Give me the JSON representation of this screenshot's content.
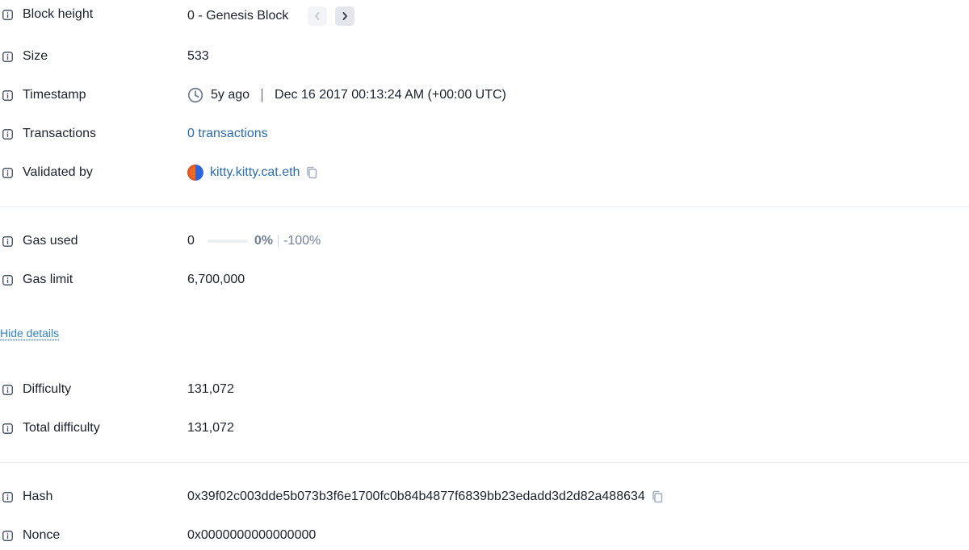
{
  "block_height": {
    "label": "Block height",
    "value": "0 - Genesis Block"
  },
  "size": {
    "label": "Size",
    "value": "533"
  },
  "timestamp": {
    "label": "Timestamp",
    "relative": "5y ago",
    "absolute": "Dec 16 2017 00:13:24 AM (+00:00 UTC)"
  },
  "transactions": {
    "label": "Transactions",
    "value": "0 transactions"
  },
  "validated_by": {
    "label": "Validated by",
    "value": "kitty.kitty.cat.eth"
  },
  "gas_used": {
    "label": "Gas used",
    "value": "0",
    "percent_label": "0%",
    "percent": 0,
    "delta": "-100%"
  },
  "gas_limit": {
    "label": "Gas limit",
    "value": "6,700,000"
  },
  "hide_details": "Hide details",
  "difficulty": {
    "label": "Difficulty",
    "value": "131,072"
  },
  "total_difficulty": {
    "label": "Total difficulty",
    "value": "131,072"
  },
  "hash": {
    "label": "Hash",
    "value": "0x39f02c003dde5b073b3f6e1700fc0b84b4877f6839bb23edadd3d2d82a488634"
  },
  "nonce": {
    "label": "Nonce",
    "value": "0x0000000000000000"
  },
  "icons": {
    "info": "info-icon",
    "prev": "chevron-left-icon",
    "next": "chevron-right-icon",
    "clock": "clock-icon",
    "copy": "copy-icon"
  },
  "colors": {
    "link": "#2b6cb0",
    "muted": "#718096",
    "divider": "#e8ebef"
  }
}
